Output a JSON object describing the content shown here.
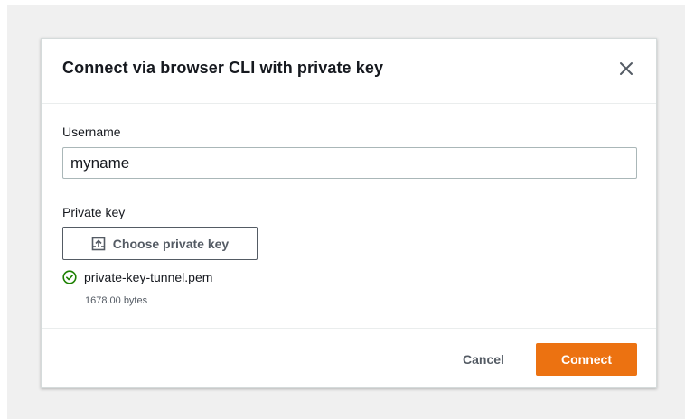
{
  "dialog": {
    "title": "Connect via browser CLI with private key",
    "close_icon": "close-icon"
  },
  "form": {
    "username": {
      "label": "Username",
      "value": "myname"
    },
    "private_key": {
      "label": "Private key",
      "button_label": "Choose private key",
      "button_icon": "upload-icon",
      "file": {
        "status_icon": "check-circle-icon",
        "name": "private-key-tunnel.pem",
        "size": "1678.00 bytes"
      }
    }
  },
  "footer": {
    "cancel_label": "Cancel",
    "connect_label": "Connect"
  },
  "colors": {
    "primary_button": "#ec7211",
    "success": "#1d8102",
    "text": "#16191f",
    "secondary_text": "#545b64"
  }
}
